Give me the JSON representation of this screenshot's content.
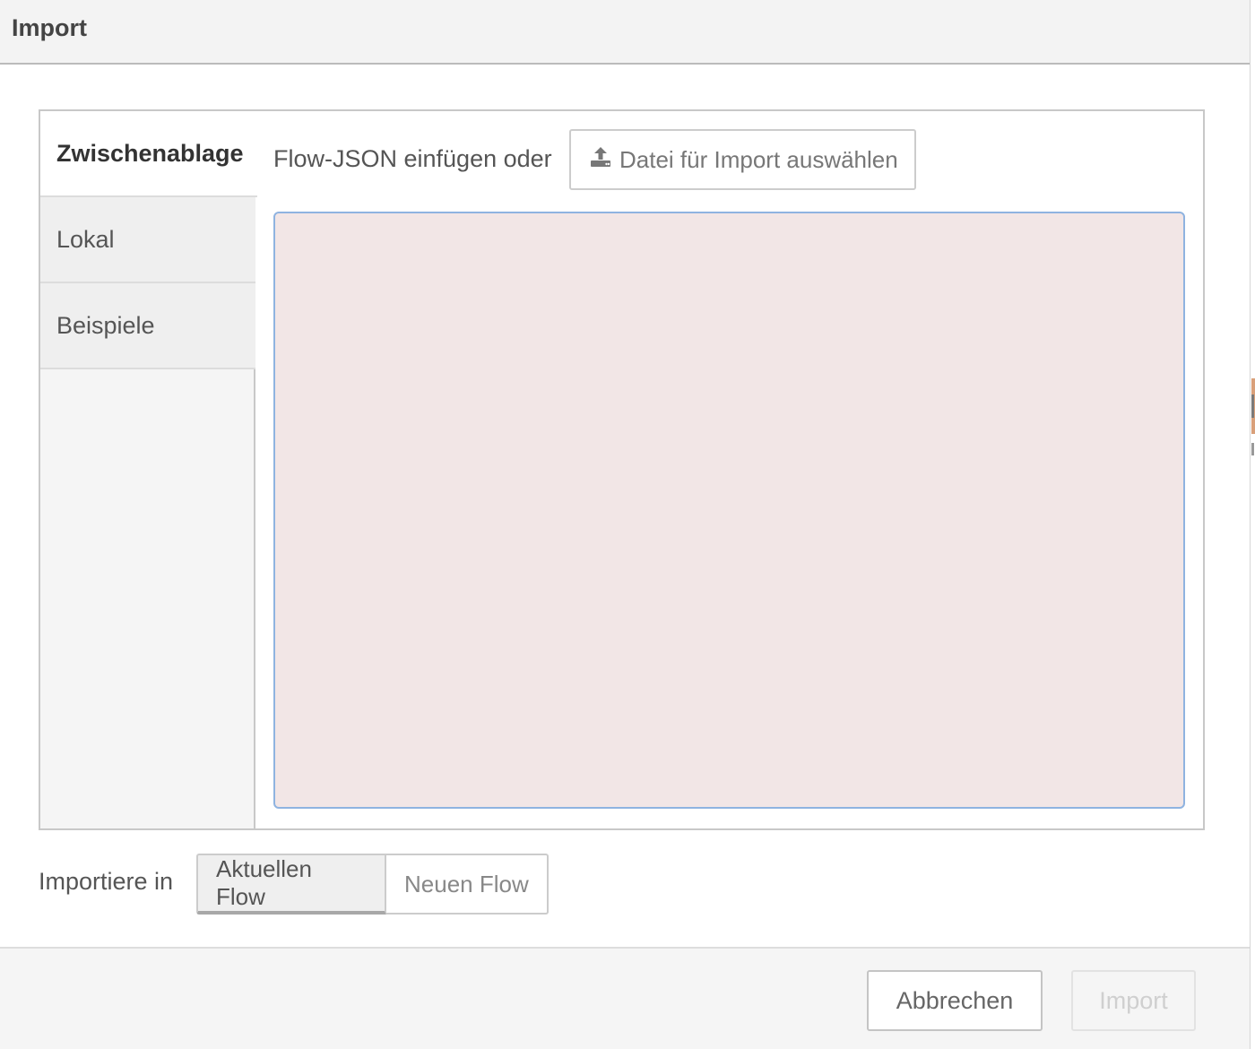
{
  "dialog": {
    "title": "Import"
  },
  "tabs": [
    {
      "label": "Zwischenablage",
      "active": true
    },
    {
      "label": "Lokal",
      "active": false
    },
    {
      "label": "Beispiele",
      "active": false
    }
  ],
  "clipboard": {
    "prompt": "Flow-JSON einfügen oder",
    "file_button_label": "Datei für Import auswählen",
    "file_button_icon": "upload-icon",
    "json_value": ""
  },
  "import_target": {
    "label": "Importiere in",
    "options": [
      {
        "label": "Aktuellen Flow",
        "selected": true
      },
      {
        "label": "Neuen Flow",
        "selected": false
      }
    ]
  },
  "footer": {
    "cancel_label": "Abbrechen",
    "import_label": "Import",
    "import_enabled": false
  },
  "colors": {
    "textarea_background": "#f2e6e6",
    "textarea_border": "#8fb3e0",
    "header_background": "#f3f3f3",
    "footer_background": "#f5f5f5"
  }
}
